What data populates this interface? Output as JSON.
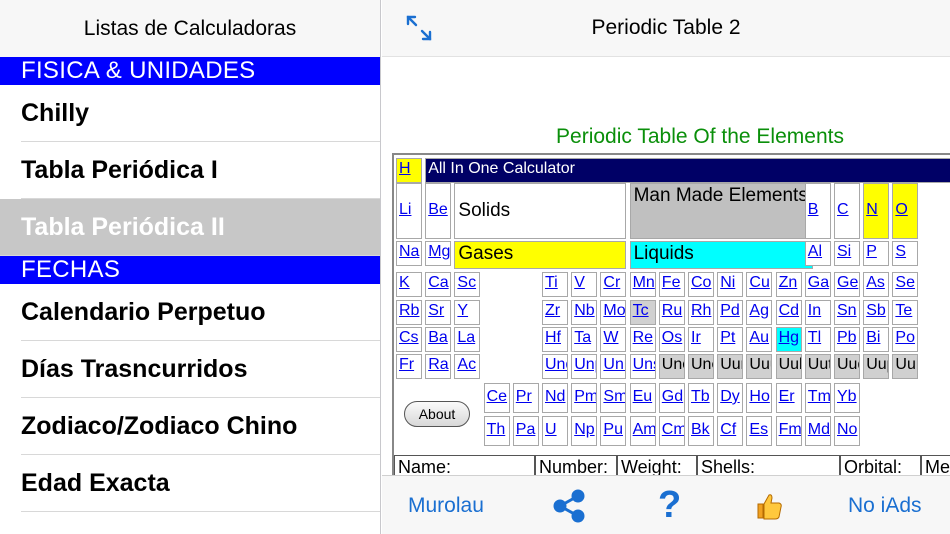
{
  "left": {
    "title": "Listas de Calculadoras",
    "section_fisica": "FISICA & UNIDADES",
    "rows_fisica": [
      "Chilly",
      "Tabla Periódica I",
      "Tabla Periódica II"
    ],
    "section_fechas": "FECHAS",
    "rows_fechas": [
      "Calendario Perpetuo",
      "Días Trasncurridos",
      "Zodiaco/Zodiaco Chino",
      "Edad Exacta"
    ],
    "selected": "Tabla Periódica II"
  },
  "right": {
    "title": "Periodic Table 2",
    "heading": "Periodic Table Of the Elements",
    "banner": "All In One Calculator",
    "categories": {
      "solids": "Solids",
      "man_made": "Man Made Elements",
      "gases": "Gases",
      "liquids": "Liquids"
    },
    "about": "About",
    "info_labels": {
      "name": "Name:",
      "number": "Number:",
      "weight": "Weight:",
      "shells": "Shells:",
      "orbital": "Orbital:",
      "melt": "Melt"
    }
  },
  "elements": {
    "row1": [
      "H"
    ],
    "row2": [
      "Li",
      "Be",
      "B",
      "C",
      "N",
      "O"
    ],
    "row3": [
      "Na",
      "Mg",
      "Al",
      "Si",
      "P",
      "S"
    ],
    "row4": [
      "K",
      "Ca",
      "Sc",
      "Ti",
      "V",
      "Cr",
      "Mn",
      "Fe",
      "Co",
      "Ni",
      "Cu",
      "Zn",
      "Ga",
      "Ge",
      "As",
      "Se"
    ],
    "row5": [
      "Rb",
      "Sr",
      "Y",
      "Zr",
      "Nb",
      "Mo",
      "Tc",
      "Ru",
      "Rh",
      "Pd",
      "Ag",
      "Cd",
      "In",
      "Sn",
      "Sb",
      "Te"
    ],
    "row6": [
      "Cs",
      "Ba",
      "La",
      "Hf",
      "Ta",
      "W",
      "Re",
      "Os",
      "Ir",
      "Pt",
      "Au",
      "Hg",
      "Tl",
      "Pb",
      "Bi",
      "Po"
    ],
    "row7": [
      "Fr",
      "Ra",
      "Ac",
      "Unq",
      "Unp",
      "Unh",
      "Uns",
      "Uno",
      "Une",
      "Uun",
      "Uuu",
      "Uub",
      "Uut",
      "Uuq",
      "Uup",
      "Uuh"
    ],
    "lanth": [
      "Ce",
      "Pr",
      "Nd",
      "Pm",
      "Sm",
      "Eu",
      "Gd",
      "Tb",
      "Dy",
      "Ho",
      "Er",
      "Tm",
      "Yb"
    ],
    "actin": [
      "Th",
      "Pa",
      "U",
      "Np",
      "Pu",
      "Am",
      "Cm",
      "Bk",
      "Cf",
      "Es",
      "Fm",
      "Md",
      "No"
    ]
  },
  "toolbar": {
    "murolau": "Murolau",
    "share_icon": "share-icon",
    "help_icon": "question-icon",
    "like_icon": "thumbs-up-icon",
    "no_iads": "No iAds"
  },
  "colors": {
    "section": "#0000ff",
    "accent": "#1a6fd1",
    "heading": "#0a8f0a",
    "banner": "#000066"
  }
}
